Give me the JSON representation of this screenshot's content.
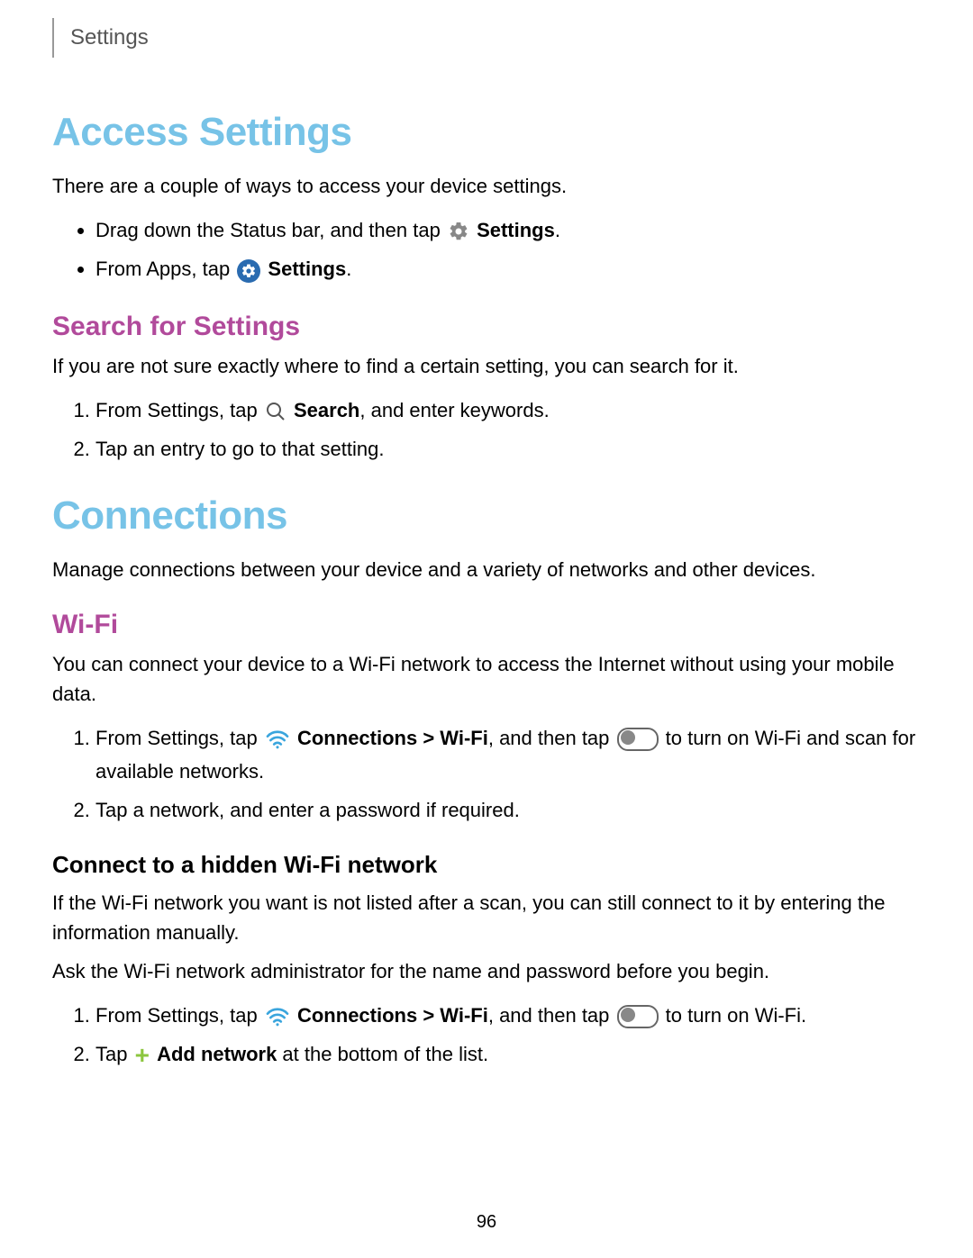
{
  "header": {
    "tab": "Settings"
  },
  "section1": {
    "title": "Access Settings",
    "intro": "There are a couple of ways to access your device settings.",
    "bullet1_pre": "Drag down the Status bar, and then tap ",
    "bullet1_bold": "Settings",
    "bullet1_post": ".",
    "bullet2_pre": "From Apps, tap ",
    "bullet2_bold": "Settings",
    "bullet2_post": "."
  },
  "search": {
    "title": "Search for Settings",
    "intro": "If you are not sure exactly where to find a certain setting, you can search for it.",
    "step1_pre": "From Settings, tap ",
    "step1_bold": "Search",
    "step1_post": ", and enter keywords.",
    "step2": "Tap an entry to go to that setting."
  },
  "section2": {
    "title": "Connections",
    "intro": "Manage connections between your device and a variety of networks and other devices."
  },
  "wifi": {
    "title": "Wi-Fi",
    "intro": "You can connect your device to a Wi-Fi network to access the Internet without using your mobile data.",
    "step1_pre": "From Settings, tap ",
    "step1_bold": "Connections > Wi-Fi",
    "step1_mid": ", and then tap ",
    "step1_post": " to turn on Wi-Fi and scan for available networks.",
    "step2": "Tap a network, and enter a password if required."
  },
  "hidden": {
    "title": "Connect to a hidden Wi-Fi network",
    "intro": "If the Wi-Fi network you want is not listed after a scan, you can still connect to it by entering the information manually.",
    "note": "Ask the Wi-Fi network administrator for the name and password before you begin.",
    "step1_pre": "From Settings, tap ",
    "step1_bold": "Connections > Wi-Fi",
    "step1_mid": ", and then tap ",
    "step1_post": " to turn on Wi-Fi.",
    "step2_pre": "Tap ",
    "step2_bold": "Add network",
    "step2_post": " at the bottom of the list."
  },
  "page_number": "96"
}
